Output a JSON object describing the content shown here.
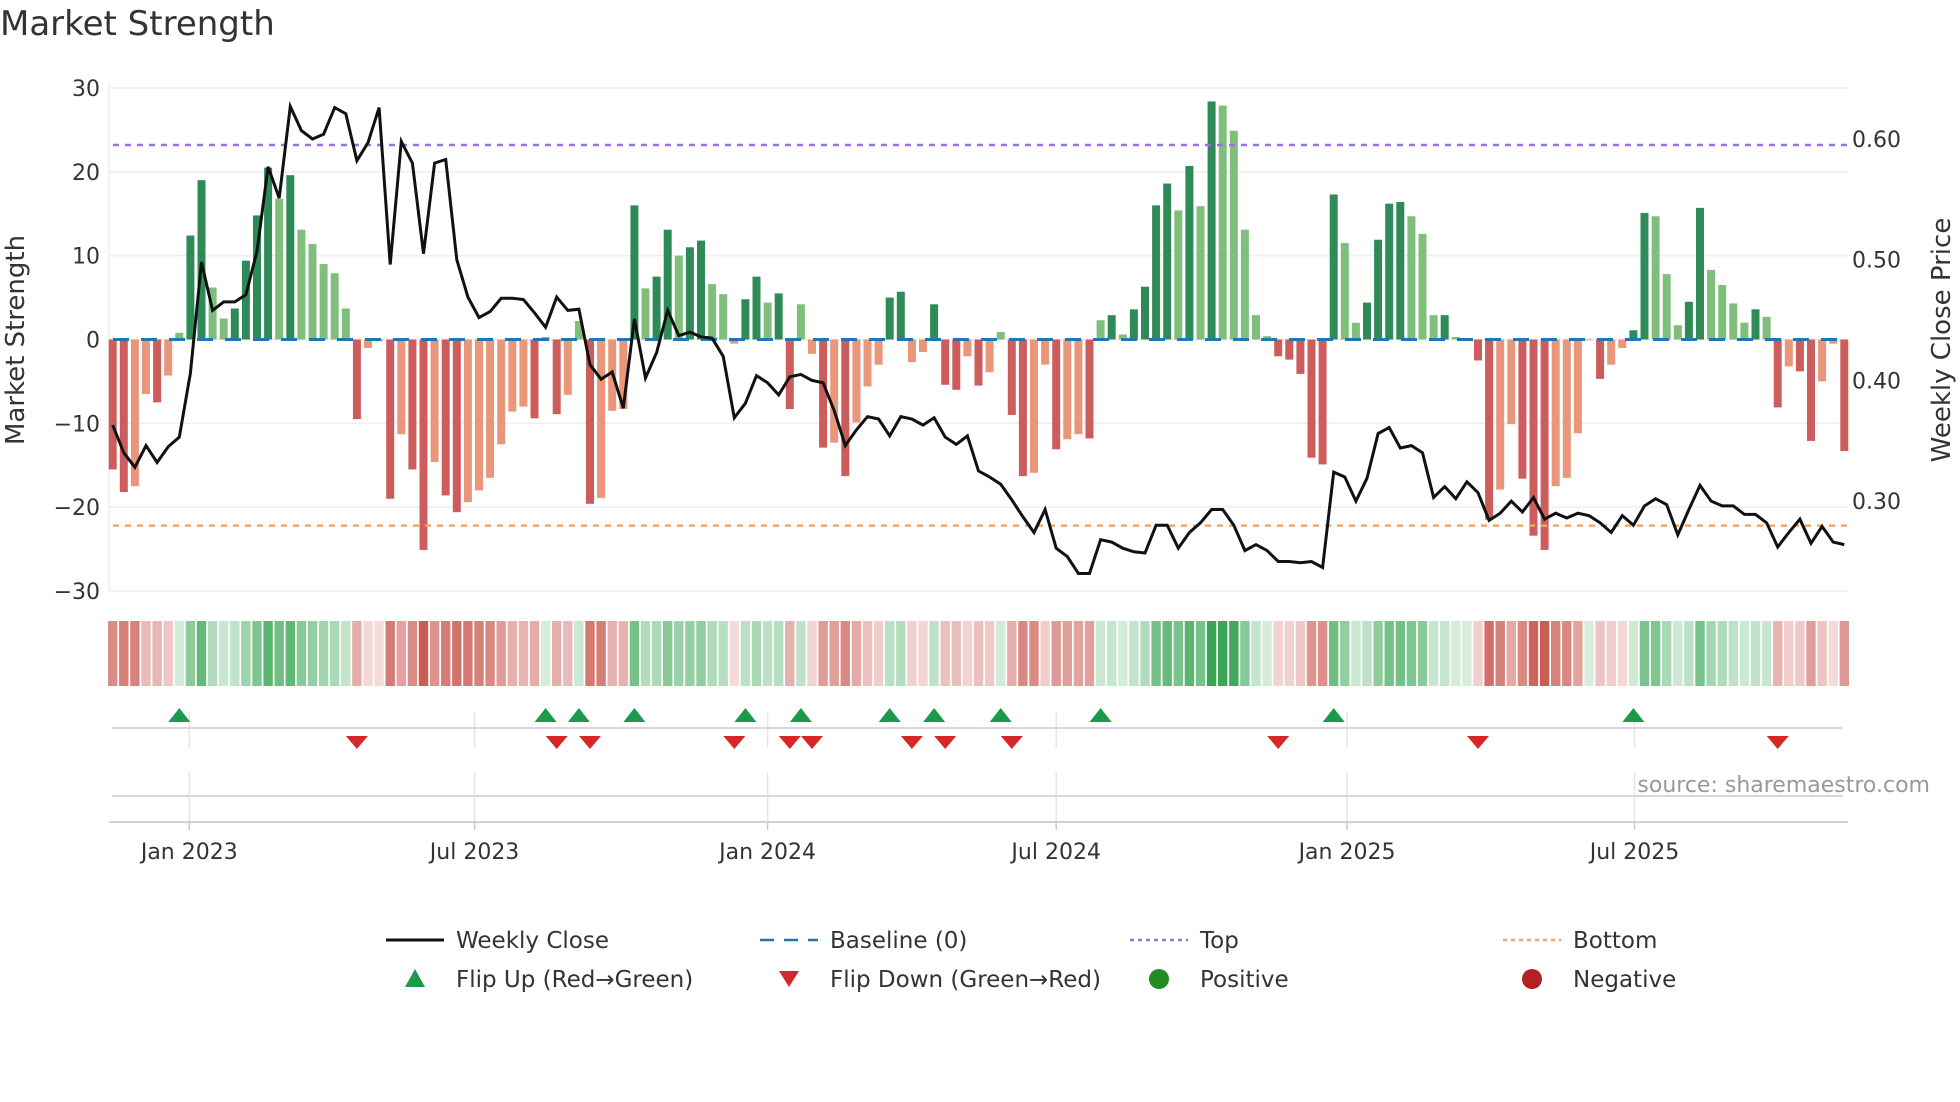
{
  "title": "Market Strength",
  "source": "source: sharemaestro.com",
  "colors": {
    "pos_dark": "#2e8b57",
    "pos_light": "#7fbf7b",
    "neg_dark": "#cd5c5c",
    "neg_light": "#e9967a",
    "line": "#111111",
    "baseline": "#1f77b4",
    "top": "#9b6fdc",
    "bottom": "#f0a868",
    "flip_up": "#1a9a4a",
    "flip_down": "#d62728",
    "positive": "#228b22",
    "negative": "#b22222"
  },
  "chart_data": {
    "type": "bar",
    "title": "Market Strength",
    "ylabel": "Market Strength",
    "y2label": "Weekly Close Price",
    "ylim": [
      -30,
      30
    ],
    "y2lim": [
      0.2347,
      0.6435
    ],
    "yticks": [
      "30",
      "20",
      "10",
      "0",
      "−10",
      "−20",
      "−30"
    ],
    "ytick_values": [
      30,
      20,
      10,
      0,
      -10,
      -20,
      -30
    ],
    "y2ticks": [
      "0.60",
      "0.50",
      "0.40",
      "0.30"
    ],
    "y2tick_values": [
      0.6,
      0.5,
      0.4,
      0.3
    ],
    "x_unit": "week index",
    "xticks": [
      {
        "label": "Jan 2023",
        "week": 6.9
      },
      {
        "label": "Jul 2023",
        "week": 32.6
      },
      {
        "label": "Jan 2024",
        "week": 59.0
      },
      {
        "label": "Jul 2024",
        "week": 85.0
      },
      {
        "label": "Jan 2025",
        "week": 111.2
      },
      {
        "label": "Jul 2025",
        "week": 137.1
      }
    ],
    "top_level": 23.2,
    "bottom_level": -22.2,
    "strength": [
      -15.5,
      -18.2,
      -17.5,
      -6.5,
      -7.5,
      -4.3,
      0.8,
      12.4,
      19,
      6.2,
      2.5,
      3.7,
      9.4,
      14.8,
      20.5,
      16.8,
      19.6,
      13.1,
      11.4,
      9,
      7.9,
      3.7,
      -9.5,
      -1,
      -0.2,
      -19,
      -11.3,
      -15.5,
      -25.1,
      -14.6,
      -18.6,
      -20.6,
      -19.4,
      -18,
      -16.5,
      -12.5,
      -8.6,
      -8,
      -9.4,
      0.3,
      -8.9,
      -6.6,
      2.2,
      -19.6,
      -18.9,
      -8.5,
      -8.3,
      16,
      6.1,
      7.5,
      13.1,
      10,
      11,
      11.8,
      6.6,
      5.4,
      -0.5,
      4.8,
      7.5,
      4.4,
      5.5,
      -8.3,
      4.2,
      -1.7,
      -12.9,
      -12.3,
      -16.3,
      -9.9,
      -5.6,
      -3,
      5,
      5.7,
      -2.7,
      -1.5,
      4.2,
      -5.4,
      -6,
      -2,
      -5.5,
      -3.9,
      0.9,
      -9,
      -16.3,
      -15.9,
      -3,
      -13.1,
      -11.9,
      -11.3,
      -11.8,
      2.3,
      2.9,
      0.6,
      3.6,
      6.3,
      16,
      18.6,
      15.4,
      20.7,
      15.9,
      28.4,
      27.9,
      24.9,
      13.1,
      2.9,
      0.4,
      -2,
      -2.4,
      -4.1,
      -14.1,
      -14.9,
      17.3,
      11.5,
      2,
      4.4,
      11.9,
      16.2,
      16.4,
      14.7,
      12.6,
      2.9,
      2.9,
      0.3,
      0.1,
      -2.5,
      -21.5,
      -17.9,
      -10.1,
      -16.6,
      -23.4,
      -25.1,
      -17.5,
      -16.5,
      -11.2,
      0,
      -4.7,
      -3,
      -1,
      1.1,
      15.1,
      14.7,
      7.8,
      1.7,
      4.5,
      15.7,
      8.3,
      6.5,
      4.3,
      2,
      3.6,
      2.7,
      -8.1,
      -3.2,
      -3.8,
      -12.1,
      -5,
      -0.5,
      -13.3
    ],
    "weekly_close": [
      0.363,
      0.34,
      0.328,
      0.346,
      0.332,
      0.345,
      0.353,
      0.406,
      0.498,
      0.458,
      0.465,
      0.465,
      0.471,
      0.507,
      0.577,
      0.551,
      0.627,
      0.607,
      0.6,
      0.604,
      0.626,
      0.621,
      0.582,
      0.597,
      0.626,
      0.496,
      0.598,
      0.58,
      0.505,
      0.58,
      0.583,
      0.5,
      0.469,
      0.452,
      0.457,
      0.468,
      0.468,
      0.467,
      0.456,
      0.444,
      0.469,
      0.458,
      0.459,
      0.413,
      0.401,
      0.407,
      0.377,
      0.451,
      0.402,
      0.423,
      0.458,
      0.437,
      0.44,
      0.436,
      0.435,
      0.42,
      0.369,
      0.381,
      0.404,
      0.398,
      0.388,
      0.403,
      0.405,
      0.4,
      0.398,
      0.375,
      0.346,
      0.359,
      0.37,
      0.368,
      0.354,
      0.37,
      0.368,
      0.363,
      0.369,
      0.353,
      0.347,
      0.354,
      0.325,
      0.32,
      0.314,
      0.301,
      0.287,
      0.274,
      0.293,
      0.261,
      0.254,
      0.24,
      0.24,
      0.268,
      0.266,
      0.261,
      0.258,
      0.257,
      0.28,
      0.28,
      0.261,
      0.274,
      0.282,
      0.293,
      0.293,
      0.28,
      0.259,
      0.264,
      0.259,
      0.25,
      0.25,
      0.249,
      0.25,
      0.245,
      0.324,
      0.32,
      0.3,
      0.319,
      0.356,
      0.361,
      0.344,
      0.346,
      0.34,
      0.303,
      0.312,
      0.302,
      0.316,
      0.307,
      0.284,
      0.29,
      0.3,
      0.291,
      0.303,
      0.285,
      0.29,
      0.286,
      0.29,
      0.288,
      0.282,
      0.274,
      0.288,
      0.28,
      0.296,
      0.302,
      0.297,
      0.272,
      0.293,
      0.313,
      0.3,
      0.296,
      0.296,
      0.289,
      0.289,
      0.282,
      0.262,
      0.274,
      0.285,
      0.265,
      0.279,
      0.266,
      0.264
    ],
    "flip_up_weeks": [
      6,
      39,
      42,
      47,
      57,
      62,
      70,
      74,
      80,
      89,
      110,
      137
    ],
    "flip_down_weeks": [
      22,
      40,
      43,
      56,
      61,
      63,
      72,
      75,
      81,
      105,
      123,
      150
    ],
    "legend": {
      "placement": "bottom",
      "items": [
        {
          "key": "line",
          "label": "Weekly Close"
        },
        {
          "key": "baseline",
          "label": "Baseline (0)"
        },
        {
          "key": "top",
          "label": "Top"
        },
        {
          "key": "bottom",
          "label": "Bottom"
        },
        {
          "key": "flip_up",
          "label": "Flip Up (Red→Green)"
        },
        {
          "key": "flip_down",
          "label": "Flip Down (Green→Red)"
        },
        {
          "key": "positive",
          "label": "Positive"
        },
        {
          "key": "negative",
          "label": "Negative"
        }
      ]
    }
  }
}
